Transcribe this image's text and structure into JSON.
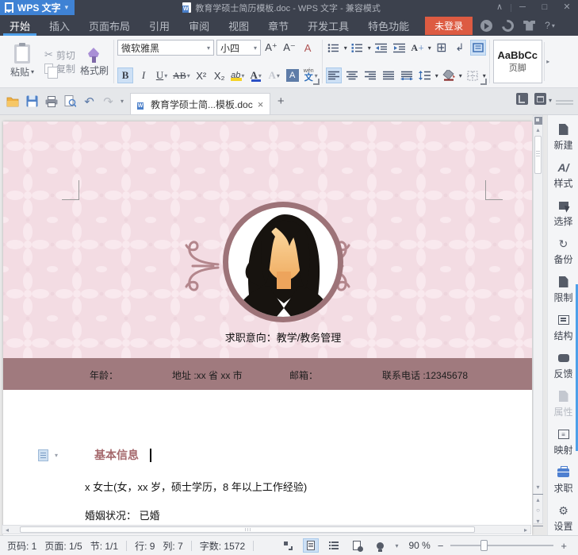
{
  "titlebar": {
    "logo_text": "WPS 文字",
    "doc_title": "教育学硕士简历模板.doc - WPS 文字 - 兼容模式"
  },
  "menu": {
    "tabs": [
      "开始",
      "插入",
      "页面布局",
      "引用",
      "审阅",
      "视图",
      "章节",
      "开发工具",
      "特色功能"
    ],
    "login": "未登录"
  },
  "ribbon": {
    "paste": "粘贴",
    "cut": "剪切",
    "copy": "复制",
    "format_painter": "格式刷",
    "font_name": "微软雅黑",
    "font_size": "小四",
    "style_preview": "AaBbCc",
    "style_name": "页脚"
  },
  "tabbar": {
    "doc_tab": "教育学硕士简...模板.doc"
  },
  "document": {
    "objective": "求职意向：教学/教务管理",
    "info_age": "年龄：",
    "info_address": "地址 :xx 省 xx 市",
    "info_email": "邮箱：",
    "info_phone": "联系电话 :12345678",
    "section_heading": "基本信息",
    "body_line1": "x 女士(女，xx 岁，硕士学历，8 年以上工作经验)",
    "body_line2": "婚姻状况：  已婚"
  },
  "sidebar": {
    "items": [
      {
        "label": "新建"
      },
      {
        "label": "样式"
      },
      {
        "label": "选择"
      },
      {
        "label": "备份"
      },
      {
        "label": "限制"
      },
      {
        "label": "结构"
      },
      {
        "label": "反馈"
      },
      {
        "label": "属性"
      },
      {
        "label": "映射"
      },
      {
        "label": "求职"
      },
      {
        "label": "设置"
      }
    ]
  },
  "statusbar": {
    "page_no": "页码: 1",
    "page": "页面: 1/5",
    "section": "节: 1/1",
    "line": "行: 9",
    "column": "列: 7",
    "words": "字数: 1572",
    "zoom": "90 %"
  },
  "icons": {
    "caret": "▾",
    "caret_up": "▴",
    "caret_right": "▸",
    "caret_left": "◂",
    "collapse": "∧",
    "minimize": "─",
    "maximize": "□",
    "close": "✕",
    "tab_close": "×",
    "plus": "+",
    "minus": "−",
    "scissors": "✂",
    "undo": "↶",
    "redo": "↷",
    "backup": "↻",
    "gear": "⚙",
    "grid": "⊞",
    "wrap": "↲",
    "help": "?",
    "bold": "B",
    "italic": "I",
    "underline": "U",
    "strike": "AB",
    "superscript": "X²",
    "subscript": "X₂",
    "highlight_ab": "ab",
    "font_color_a": "A",
    "ghost_a": "A",
    "box_a": "A",
    "pinyin_char": "文",
    "pinyin_tone": "wén",
    "font_grow": "A⁺",
    "font_shrink": "A⁻",
    "clear_format": "A",
    "text_effect": "A",
    "styles_a": "A/",
    "mapping_lines": "≡",
    "circle": "○"
  },
  "colors": {
    "titlebar": "#3c414d",
    "logo_blue": "#3f82d4",
    "accent_blue": "#4e9fe9",
    "login_orange": "#dd5b42",
    "band_mauve": "#a07a7e",
    "heading_mauve": "#a5686c",
    "page_pink": "#f3dce3",
    "avatar_ring": "#9d7378"
  }
}
